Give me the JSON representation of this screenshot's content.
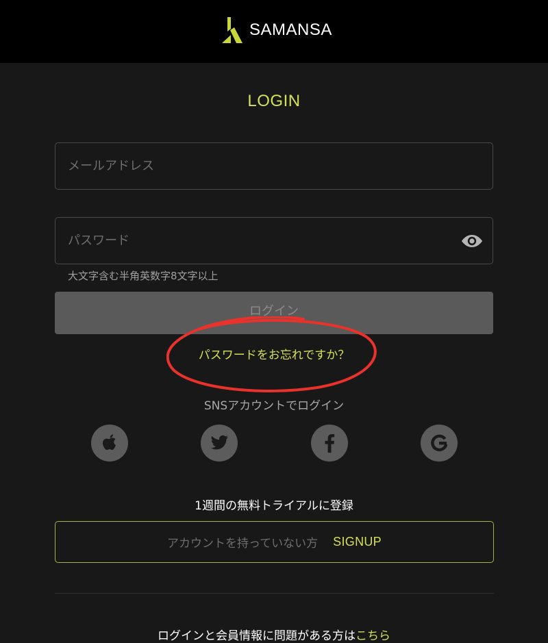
{
  "header": {
    "logo_text": "SAMANSA",
    "logo_color": "#c8d63a"
  },
  "login": {
    "title": "LOGIN",
    "email_placeholder": "メールアドレス",
    "password_placeholder": "パスワード",
    "password_hint": "大文字含む半角英数字8文字以上",
    "login_button": "ログイン",
    "forgot_password": "パスワードをお忘れですか？"
  },
  "sns": {
    "label": "SNSアカウントでログイン",
    "providers": [
      {
        "name": "apple-icon"
      },
      {
        "name": "twitter-icon"
      },
      {
        "name": "facebook-icon"
      },
      {
        "name": "google-icon"
      }
    ]
  },
  "signup": {
    "trial_text": "1週間の無料トライアルに登録",
    "prompt": "アカウントを持っていない方",
    "link": "SIGNUP"
  },
  "footer": {
    "text": "ログインと会員情報に問題がある方は",
    "link": "こちら"
  },
  "colors": {
    "accent": "#d4e157",
    "annotation_red": "#e8322b",
    "background": "#181818",
    "header_bg": "#000000"
  }
}
